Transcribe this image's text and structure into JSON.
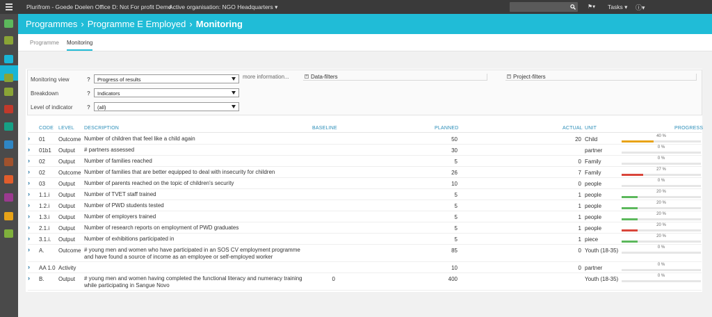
{
  "topbar": {
    "app_title": "Plurifrom - Goede Doelen Office D: Not For profit Demo",
    "org_label": "Active organisation: NGO Headquarters",
    "tasks_label": "Tasks"
  },
  "sidebar": {
    "items": [
      {
        "icon": "home-icon",
        "color": "#5cb85c"
      },
      {
        "icon": "box-icon",
        "color": "#8aa436"
      },
      {
        "icon": "folder-icon",
        "color": "#19b5d6"
      },
      {
        "icon": "sheet-icon",
        "color": "#8aa436"
      },
      {
        "icon": "calculator-icon",
        "color": "#8aa436"
      },
      {
        "icon": "car-icon",
        "color": "#c0392b"
      },
      {
        "icon": "truck-icon",
        "color": "#16a085"
      },
      {
        "icon": "document-icon",
        "color": "#2f86c4"
      },
      {
        "icon": "printer-icon",
        "color": "#a0522d"
      },
      {
        "icon": "chart-icon",
        "color": "#e05d2c"
      },
      {
        "icon": "pie-icon",
        "color": "#9b3a8f"
      },
      {
        "icon": "notes-icon",
        "color": "#e8a317"
      },
      {
        "icon": "user-icon",
        "color": "#7fb03c"
      }
    ]
  },
  "breadcrumb": {
    "items": [
      "Programmes",
      "Programme E Employed",
      "Monitoring"
    ]
  },
  "tabs": [
    "Programme",
    "Monitoring"
  ],
  "filters": {
    "monitoring_view_label": "Monitoring view",
    "monitoring_view_value": "Progress of results",
    "breakdown_label": "Breakdown",
    "breakdown_value": "Indicators",
    "level_label": "Level of indicator",
    "level_value": "(all)",
    "qmark": "?",
    "more_info": "more information...",
    "data_filters": "Data-filters",
    "project_filters": "Project-filters"
  },
  "table": {
    "headers": {
      "code": "CODE",
      "level": "LEVEL",
      "description": "DESCRIPTION",
      "baseline": "BASELINE",
      "planned": "PLANNED",
      "actual": "ACTUAL",
      "unit": "UNIT",
      "progress": "PROGRESS"
    },
    "rows": [
      {
        "code": "01",
        "level": "Outcome",
        "description": "Number of children that feel like a child again",
        "baseline": "",
        "planned": "50",
        "actual": "20",
        "unit": "Child",
        "progress_label": "40 %",
        "progress": 0.4,
        "bar_color": "#e8a317"
      },
      {
        "code": "01b1",
        "level": "Output",
        "description": "# partners assessed",
        "baseline": "",
        "planned": "30",
        "actual": "",
        "unit": "partner",
        "progress_label": "0 %",
        "progress": 0,
        "bar_color": "#5cb85c"
      },
      {
        "code": "02",
        "level": "Output",
        "description": "Number of families reached",
        "baseline": "",
        "planned": "5",
        "actual": "0",
        "unit": "Family",
        "progress_label": "0 %",
        "progress": 0,
        "bar_color": "#5cb85c"
      },
      {
        "code": "02",
        "level": "Outcome",
        "description": "Number of families that are better equipped to deal with insecurity for children",
        "baseline": "",
        "planned": "26",
        "actual": "7",
        "unit": "Family",
        "progress_label": "27 %",
        "progress": 0.27,
        "bar_color": "#d9453a"
      },
      {
        "code": "03",
        "level": "Output",
        "description": "Number of parents reached on the topic of children's security",
        "baseline": "",
        "planned": "10",
        "actual": "0",
        "unit": "people",
        "progress_label": "0 %",
        "progress": 0,
        "bar_color": "#5cb85c"
      },
      {
        "code": "1.1.i",
        "level": "Output",
        "description": "Number of TVET staff trained",
        "baseline": "",
        "planned": "5",
        "actual": "1",
        "unit": "people",
        "progress_label": "20 %",
        "progress": 0.2,
        "bar_color": "#5cb85c"
      },
      {
        "code": "1.2.i",
        "level": "Output",
        "description": "Number of PWD students tested",
        "baseline": "",
        "planned": "5",
        "actual": "1",
        "unit": "people",
        "progress_label": "20 %",
        "progress": 0.2,
        "bar_color": "#5cb85c"
      },
      {
        "code": "1.3.i",
        "level": "Output",
        "description": "Number of employers trained",
        "baseline": "",
        "planned": "5",
        "actual": "1",
        "unit": "people",
        "progress_label": "20 %",
        "progress": 0.2,
        "bar_color": "#5cb85c"
      },
      {
        "code": "2.1.i",
        "level": "Output",
        "description": "Number of research reports on employment of PWD graduates",
        "baseline": "",
        "planned": "5",
        "actual": "1",
        "unit": "people",
        "progress_label": "20 %",
        "progress": 0.2,
        "bar_color": "#d9453a"
      },
      {
        "code": "3.1.i.",
        "level": "Output",
        "description": "Number of exhibitions participated in",
        "baseline": "",
        "planned": "5",
        "actual": "1",
        "unit": "piece",
        "progress_label": "20 %",
        "progress": 0.2,
        "bar_color": "#5cb85c"
      },
      {
        "code": "A.",
        "level": "Outcome",
        "description": "# young men and women who have participated in an SOS CV employment programme and have found a source of income as an employee or self-employed worker",
        "baseline": "",
        "planned": "85",
        "actual": "0",
        "unit": "Youth (18-35)",
        "progress_label": "0 %",
        "progress": 0,
        "bar_color": "#5cb85c"
      },
      {
        "code": "AA 1.0",
        "level": "Activity",
        "description": "",
        "baseline": "",
        "planned": "10",
        "actual": "0",
        "unit": "partner",
        "progress_label": "0 %",
        "progress": 0,
        "bar_color": "#5cb85c"
      },
      {
        "code": "B.",
        "level": "Output",
        "description": "# young men and women having completed the functional literacy and numeracy training while participating in Sangue Novo",
        "baseline": "0",
        "planned": "400",
        "actual": "",
        "unit": "Youth (18-35)",
        "progress_label": "0 %",
        "progress": 0,
        "bar_color": "#5cb85c"
      }
    ]
  }
}
